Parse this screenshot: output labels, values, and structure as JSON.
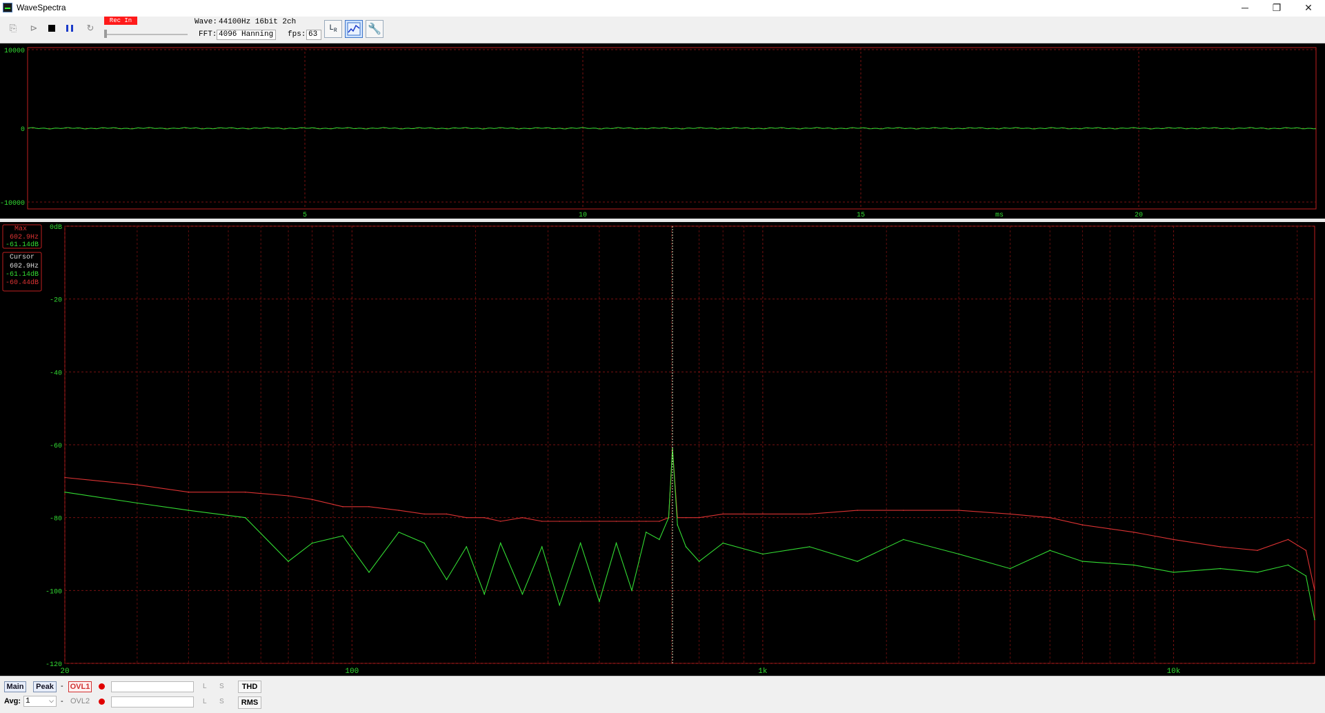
{
  "window": {
    "title": "WaveSpectra",
    "controls": [
      "─",
      "❐",
      "✕"
    ]
  },
  "toolbar": {
    "rec_badge": "Rec In",
    "wave_label": "Wave:",
    "wave_value": "44100Hz 16bit 2ch",
    "fft_label": "FFT:",
    "fft_value": "4096 Hanning",
    "fps_label": "fps:",
    "fps_value": "63"
  },
  "colors": {
    "ch1": "#33dd33",
    "ch2": "#dd3333",
    "frame": "#c02020",
    "grid": "#7a1010",
    "axis_text": "#33dd33"
  },
  "waveform": {
    "y_ticks": [
      "10000",
      "0",
      "-10000"
    ],
    "x_ticks": [
      "5",
      "10",
      "15",
      "20"
    ],
    "x_unit": "ms"
  },
  "spectrum": {
    "y_ticks": [
      "0dB",
      "-20",
      "-40",
      "-60",
      "-80",
      "-100",
      "-120"
    ],
    "x_ticks": [
      "20",
      "100",
      "1k",
      "10k"
    ],
    "max_box": {
      "title": "Max",
      "freq": "602.9Hz",
      "level": "-61.14dB"
    },
    "cursor_box": {
      "title": "Cursor",
      "freq": "602.9Hz",
      "level_ch1": "-61.14dB",
      "level_ch2": "-60.44dB"
    }
  },
  "chart_data": {
    "type": "line",
    "x_scale": "log",
    "xlim": [
      20,
      22050
    ],
    "ylim": [
      -120,
      0
    ],
    "xlabel": "",
    "ylabel": "",
    "cursor_x": 602.9,
    "series": [
      {
        "color": "#33dd33",
        "x": [
          20,
          30,
          40,
          55,
          70,
          80,
          95,
          110,
          130,
          150,
          170,
          190,
          210,
          230,
          260,
          290,
          320,
          360,
          400,
          440,
          480,
          520,
          560,
          590,
          603,
          620,
          650,
          700,
          800,
          1000,
          1300,
          1700,
          2200,
          3000,
          4000,
          5000,
          6000,
          8000,
          10000,
          13000,
          16000,
          19000,
          21000,
          22050
        ],
        "y": [
          -73,
          -76,
          -78,
          -80,
          -92,
          -87,
          -85,
          -95,
          -84,
          -87,
          -97,
          -88,
          -101,
          -87,
          -101,
          -88,
          -104,
          -87,
          -103,
          -87,
          -100,
          -84,
          -86,
          -80,
          -61,
          -82,
          -88,
          -92,
          -87,
          -90,
          -88,
          -92,
          -86,
          -90,
          -94,
          -89,
          -92,
          -93,
          -95,
          -94,
          -95,
          -93,
          -96,
          -108
        ]
      },
      {
        "color": "#dd3333",
        "x": [
          20,
          30,
          40,
          55,
          70,
          80,
          95,
          110,
          130,
          150,
          170,
          190,
          210,
          230,
          260,
          290,
          320,
          360,
          400,
          440,
          480,
          520,
          560,
          590,
          603,
          620,
          650,
          700,
          800,
          1000,
          1300,
          1700,
          2200,
          3000,
          4000,
          5000,
          6000,
          8000,
          10000,
          13000,
          16000,
          19000,
          21000,
          22050
        ],
        "y": [
          -69,
          -71,
          -73,
          -73,
          -74,
          -75,
          -77,
          -77,
          -78,
          -79,
          -79,
          -80,
          -80,
          -81,
          -80,
          -81,
          -81,
          -81,
          -81,
          -81,
          -81,
          -81,
          -81,
          -80,
          -61,
          -80,
          -80,
          -80,
          -79,
          -79,
          -79,
          -78,
          -78,
          -78,
          -79,
          -80,
          -82,
          -84,
          -86,
          -88,
          -89,
          -86,
          -89,
          -100
        ]
      }
    ]
  },
  "statusbar": {
    "main": "Main",
    "peak": "Peak",
    "dash": "-",
    "ovl1": "OVL1",
    "ovl2": "OVL2",
    "l": "L",
    "s": "S",
    "thd": "THD",
    "rms": "RMS",
    "avg_label": "Avg:",
    "avg_value": "1"
  }
}
